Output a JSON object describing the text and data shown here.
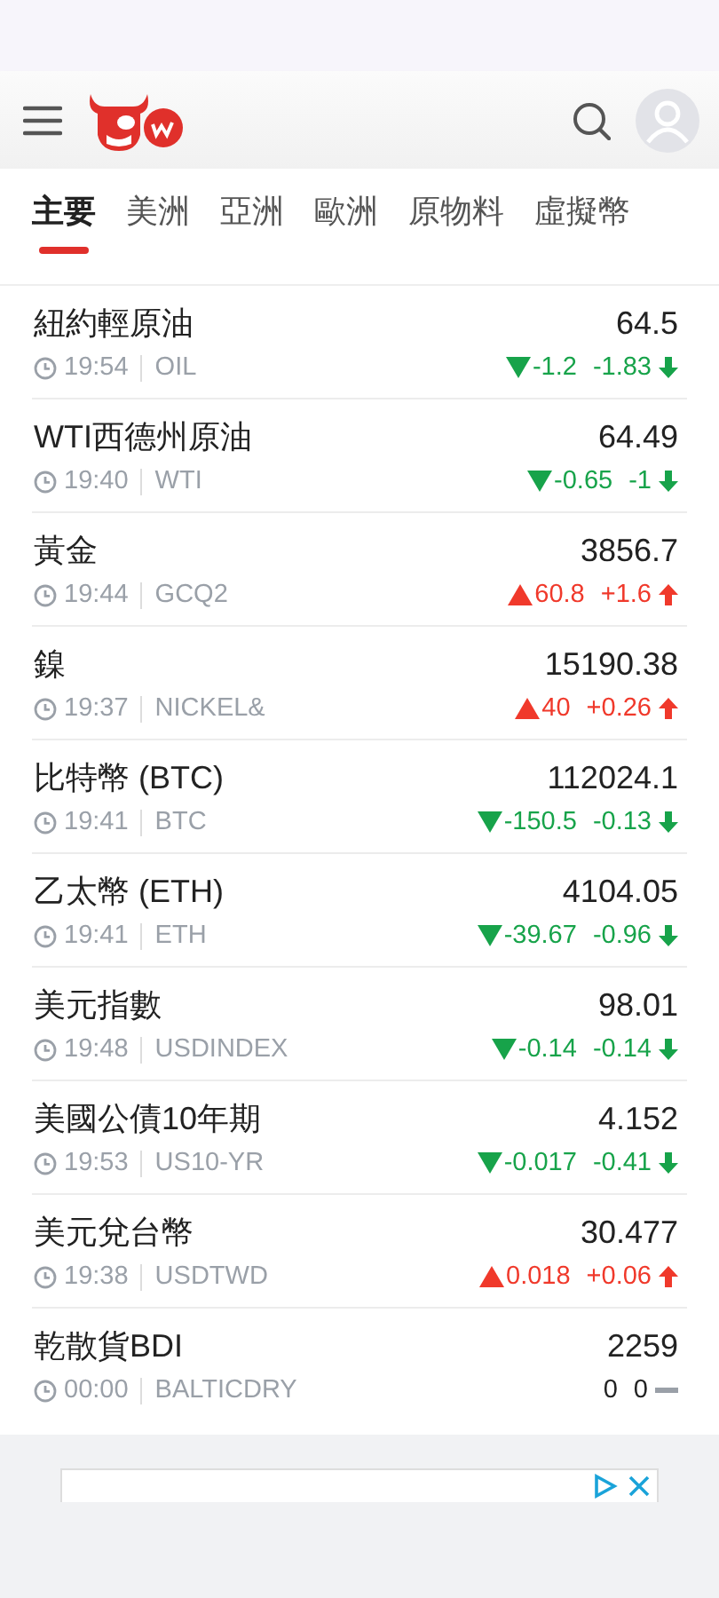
{
  "tabs": [
    {
      "label": "主要",
      "selected": true
    },
    {
      "label": "美洲",
      "selected": false
    },
    {
      "label": "亞洲",
      "selected": false
    },
    {
      "label": "歐洲",
      "selected": false
    },
    {
      "label": "原物料",
      "selected": false
    },
    {
      "label": "虛擬幣",
      "selected": false
    }
  ],
  "quotes": [
    {
      "name": "紐約輕原油",
      "time": "19:54",
      "symbol": "OIL",
      "price": "64.5",
      "change": "-1.2",
      "percent": "-1.83",
      "kind": "down"
    },
    {
      "name": "WTI西德州原油",
      "time": "19:40",
      "symbol": "WTI",
      "price": "64.49",
      "change": "-0.65",
      "percent": "-1",
      "kind": "down"
    },
    {
      "name": "黃金",
      "time": "19:44",
      "symbol": "GCQ2",
      "price": "3856.7",
      "change": "60.8",
      "percent": "+1.6",
      "kind": "up"
    },
    {
      "name": "鎳",
      "time": "19:37",
      "symbol": "NICKEL&",
      "price": "15190.38",
      "change": "40",
      "percent": "+0.26",
      "kind": "up"
    },
    {
      "name": "比特幣 (BTC)",
      "time": "19:41",
      "symbol": "BTC",
      "price": "112024.1",
      "change": "-150.5",
      "percent": "-0.13",
      "kind": "down"
    },
    {
      "name": "乙太幣 (ETH)",
      "time": "19:41",
      "symbol": "ETH",
      "price": "4104.05",
      "change": "-39.67",
      "percent": "-0.96",
      "kind": "down"
    },
    {
      "name": "美元指數",
      "time": "19:48",
      "symbol": "USDINDEX",
      "price": "98.01",
      "change": "-0.14",
      "percent": "-0.14",
      "kind": "down"
    },
    {
      "name": "美國公債10年期",
      "time": "19:53",
      "symbol": "US10-YR",
      "price": "4.152",
      "change": "-0.017",
      "percent": "-0.41",
      "kind": "down"
    },
    {
      "name": "美元兌台幣",
      "time": "19:38",
      "symbol": "USDTWD",
      "price": "30.477",
      "change": "0.018",
      "percent": "+0.06",
      "kind": "up"
    },
    {
      "name": "乾散貨BDI",
      "time": "00:00",
      "symbol": "BALTICDRY",
      "price": "2259",
      "change": "0",
      "percent": "0",
      "kind": "flat"
    }
  ]
}
